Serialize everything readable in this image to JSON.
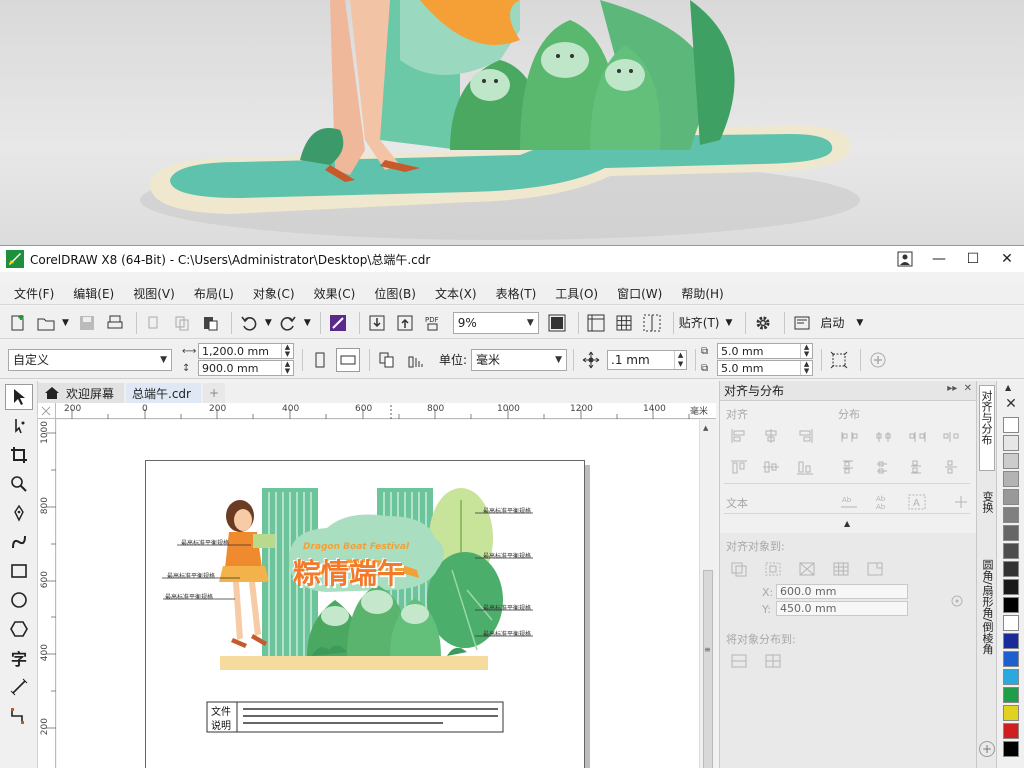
{
  "window": {
    "title": "CorelDRAW X8 (64-Bit) - C:\\Users\\Administrator\\Desktop\\总端午.cdr"
  },
  "menu": [
    "文件(F)",
    "编辑(E)",
    "视图(V)",
    "布局(L)",
    "对象(C)",
    "效果(C)",
    "位图(B)",
    "文本(X)",
    "表格(T)",
    "工具(O)",
    "窗口(W)",
    "帮助(H)"
  ],
  "toolbar1": {
    "zoom": "9%",
    "snap_label": "贴齐(T)",
    "launch_label": "启动"
  },
  "toolbar2": {
    "page_preset": "自定义",
    "width": "1,200.0 mm",
    "height": "900.0 mm",
    "units_label": "单位:",
    "units": "毫米",
    "nudge": ".1 mm",
    "dup_x": "5.0 mm",
    "dup_y": "5.0 mm"
  },
  "tabs": [
    {
      "label": "欢迎屏幕",
      "active": false
    },
    {
      "label": "总端午.cdr",
      "active": true
    }
  ],
  "ruler": {
    "h_ticks": [
      "200",
      "0",
      "200",
      "400",
      "600",
      "800",
      "1000",
      "1200",
      "1400"
    ],
    "h_unit": "毫米",
    "v_ticks": [
      "1000",
      "800",
      "600",
      "400",
      "200"
    ]
  },
  "design": {
    "title_en": "Dragon Boat Festival",
    "title_cn": "粽情端午",
    "callout": "最高标准平衡规格",
    "note_label_1": "文件",
    "note_label_2": "说明"
  },
  "docker": {
    "title": "对齐与分布",
    "align_label": "对齐",
    "distribute_label": "分布",
    "text_label": "文本",
    "align_to_label": "对齐对象到:",
    "x_value": "600.0 mm",
    "y_value": "450.0 mm",
    "x_label": "X:",
    "y_label": "Y:",
    "distribute_to_label": "将对象分布到:"
  },
  "side_tabs": [
    "对齐与分布",
    "变换",
    "圆角/扇形角/倒棱角"
  ],
  "palette_colors": [
    "#ffffff",
    "#e6e6e6",
    "#cccccc",
    "#b3b3b3",
    "#999999",
    "#808080",
    "#666666",
    "#4d4d4d",
    "#333333",
    "#1a1a1a",
    "#000000",
    "#ffffff",
    "#1a2a9a",
    "#1e5fd0",
    "#2aa9e0",
    "#1f9e4a",
    "#e0d21e",
    "#d01e1e",
    "#000000"
  ]
}
